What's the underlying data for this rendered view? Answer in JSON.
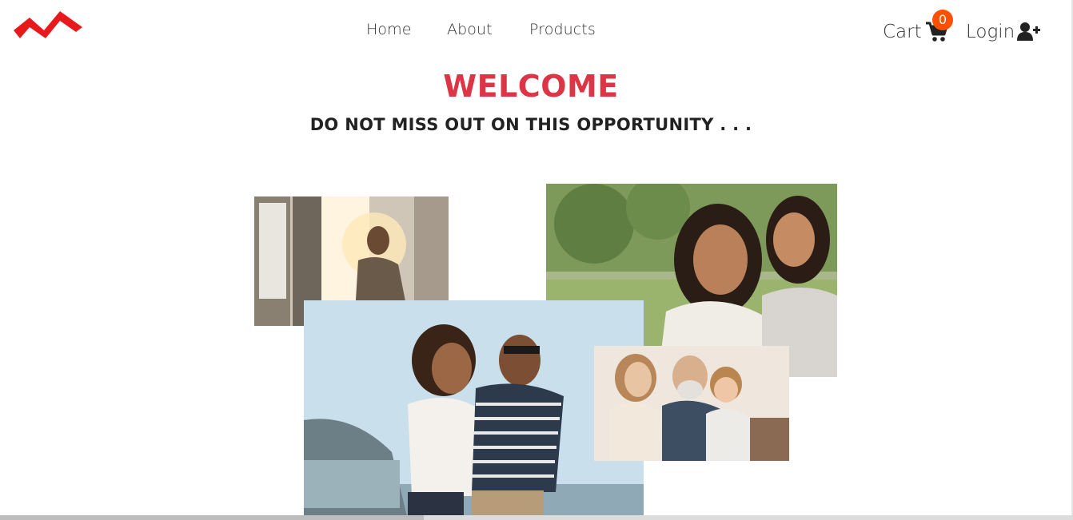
{
  "brand": {
    "logo_icon": "brand-logo-icon",
    "color": "#e8191b"
  },
  "nav": {
    "items": [
      {
        "label": "Home"
      },
      {
        "label": "About"
      },
      {
        "label": "Products"
      }
    ]
  },
  "cart": {
    "label": "Cart",
    "count": "0",
    "icon": "shopping-cart-icon",
    "badge_color": "#ff4f00"
  },
  "login": {
    "label": "Login",
    "icon": "user-plus-icon"
  },
  "hero": {
    "title": "WELCOME",
    "subtitle": "DO NOT MISS OUT ON THIS OPPORTUNITY . . .",
    "title_color": "#dc3545"
  }
}
